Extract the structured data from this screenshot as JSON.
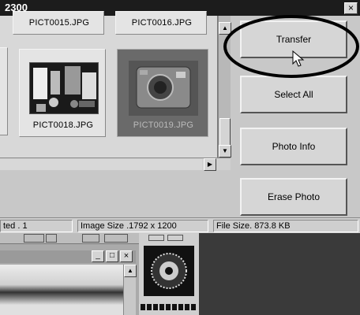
{
  "window": {
    "title": "2300",
    "close_glyph": "×"
  },
  "thumbnails": {
    "top_row": [
      "PICT0015.JPG",
      "PICT0016.JPG"
    ],
    "items": [
      {
        "filename": "PICT0018.JPG",
        "selected": false
      },
      {
        "filename": "PICT0019.JPG",
        "selected": true
      }
    ]
  },
  "buttons": {
    "transfer": "Transfer",
    "select_all": "Select All",
    "photo_info": "Photo Info",
    "erase_photo": "Erase Photo"
  },
  "status": {
    "selected": "ted . 1",
    "image_size": "Image Size .1792 x 1200",
    "file_size": "File Size. 873.8 KB"
  },
  "subwindow": {
    "minimize": "_",
    "maximize": "□",
    "close": "×"
  },
  "colors": {
    "highlight_ellipse": "#000000",
    "selected_thumb": "#6a6a6a"
  },
  "icons": [
    "close-icon",
    "scroll-up-icon",
    "scroll-down-icon",
    "scroll-right-icon",
    "mouse-cursor-icon"
  ]
}
